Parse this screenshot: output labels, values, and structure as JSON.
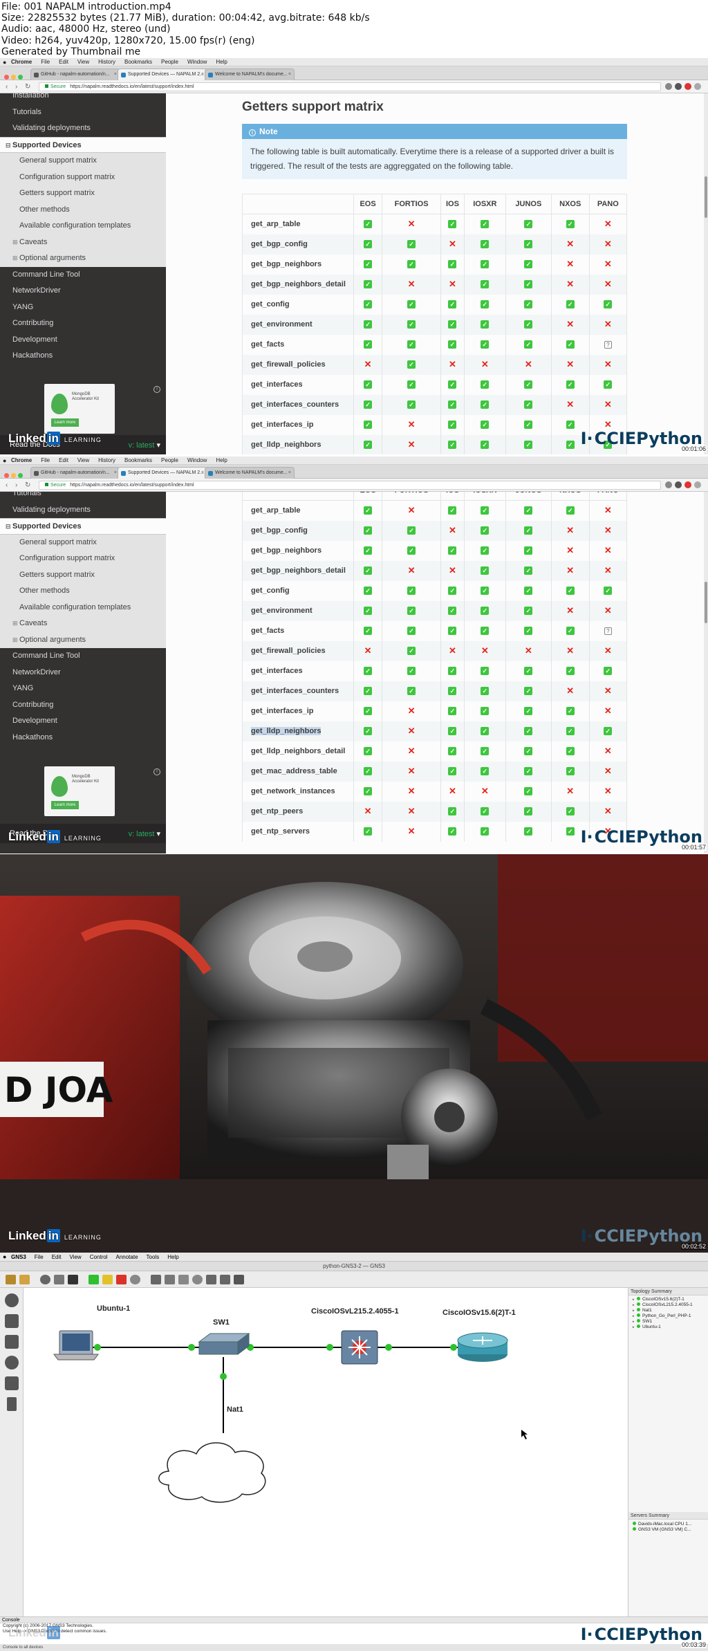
{
  "meta": {
    "lines": [
      "File: 001 NAPALM introduction.mp4",
      "Size: 22825532 bytes (21.77 MiB), duration: 00:04:42, avg.bitrate: 648 kb/s",
      "Audio: aac, 48000 Hz, stereo (und)",
      "Video: h264, yuv420p, 1280x720, 15.00 fps(r) (eng)",
      "Generated by Thumbnail me"
    ]
  },
  "browser": {
    "menu": [
      "Chrome",
      "File",
      "Edit",
      "View",
      "History",
      "Bookmarks",
      "People",
      "Window",
      "Help"
    ],
    "tabs": [
      {
        "label": "GitHub - napalm-automation/n..."
      },
      {
        "label": "Supported Devices — NAPALM 2..."
      },
      {
        "label": "Welcome to NAPALM's docume..."
      }
    ],
    "secure": "Secure",
    "url": "https://napalm.readthedocs.io/en/latest/support/index.html"
  },
  "sidebar": {
    "top_items": [
      "Installation",
      "Tutorials",
      "Validating deployments"
    ],
    "current": "Supported Devices",
    "sub_items": [
      "General support matrix",
      "Configuration support matrix",
      "Getters support matrix",
      "Other methods",
      "Available configuration templates"
    ],
    "expand_items": [
      "Caveats",
      "Optional arguments"
    ],
    "bottom_items": [
      "Command Line Tool",
      "NetworkDriver",
      "YANG",
      "Contributing",
      "Development",
      "Hackathons"
    ],
    "ad_text": "MongoDB Accelerator Kit",
    "ad_button": "Learn more",
    "rtd_label": "Read the Docs",
    "version": "v: latest"
  },
  "doc": {
    "heading": "Getters support matrix",
    "note_title": "Note",
    "note_body": "The following table is built automatically. Everytime there is a release of a supported driver a built is triggered. The result of the tests are aggreggated on the following table.",
    "columns": [
      "EOS",
      "FORTIOS",
      "IOS",
      "IOSXR",
      "JUNOS",
      "NXOS",
      "PANO"
    ],
    "rows": [
      {
        "name": "get_arp_table",
        "v": [
          "y",
          "n",
          "y",
          "y",
          "y",
          "y",
          "n"
        ]
      },
      {
        "name": "get_bgp_config",
        "v": [
          "y",
          "y",
          "n",
          "y",
          "y",
          "n",
          "n"
        ]
      },
      {
        "name": "get_bgp_neighbors",
        "v": [
          "y",
          "y",
          "y",
          "y",
          "y",
          "n",
          "n"
        ]
      },
      {
        "name": "get_bgp_neighbors_detail",
        "v": [
          "y",
          "n",
          "n",
          "y",
          "y",
          "n",
          "n"
        ]
      },
      {
        "name": "get_config",
        "v": [
          "y",
          "y",
          "y",
          "y",
          "y",
          "y",
          "y"
        ]
      },
      {
        "name": "get_environment",
        "v": [
          "y",
          "y",
          "y",
          "y",
          "y",
          "n",
          "n"
        ]
      },
      {
        "name": "get_facts",
        "v": [
          "y",
          "y",
          "y",
          "y",
          "y",
          "y",
          "z"
        ]
      },
      {
        "name": "get_firewall_policies",
        "v": [
          "n",
          "y",
          "n",
          "n",
          "n",
          "n",
          "n"
        ]
      },
      {
        "name": "get_interfaces",
        "v": [
          "y",
          "y",
          "y",
          "y",
          "y",
          "y",
          "y"
        ]
      },
      {
        "name": "get_interfaces_counters",
        "v": [
          "y",
          "y",
          "y",
          "y",
          "y",
          "n",
          "n"
        ]
      },
      {
        "name": "get_interfaces_ip",
        "v": [
          "y",
          "n",
          "y",
          "y",
          "y",
          "y",
          "n"
        ]
      },
      {
        "name": "get_lldp_neighbors",
        "v": [
          "y",
          "n",
          "y",
          "y",
          "y",
          "y",
          "y"
        ]
      },
      {
        "name": "get_lldp_neighbors_detail",
        "v": [
          "y",
          "n",
          "y",
          "y",
          "y",
          "y",
          "n"
        ]
      },
      {
        "name": "get_mac_address_table",
        "v": [
          "y",
          "n",
          "y",
          "y",
          "y",
          "y",
          "n"
        ]
      },
      {
        "name": "get_network_instances",
        "v": [
          "y",
          "n",
          "n",
          "n",
          "y",
          "n",
          "n"
        ]
      },
      {
        "name": "get_ntp_peers",
        "v": [
          "n",
          "n",
          "y",
          "y",
          "y",
          "y",
          "n"
        ]
      },
      {
        "name": "get_ntp_servers",
        "v": [
          "y",
          "n",
          "y",
          "y",
          "y",
          "y",
          "n"
        ]
      }
    ]
  },
  "watermark": {
    "linkedin": "Linked",
    "linkedin_in": "in",
    "learning": "LEARNING",
    "cciepython": "CCIEPython",
    "bars": "I·"
  },
  "timestamps": {
    "f1": "00:01:06",
    "f2": "00:01:57",
    "f3": "00:02:52",
    "f4": "00:03:39"
  },
  "plate_text": "D JOA",
  "gns3": {
    "menu": [
      "GNS3",
      "File",
      "Edit",
      "View",
      "Control",
      "Annotate",
      "Tools",
      "Help"
    ],
    "title": "python-GNS3-2 — GNS3",
    "nodes": {
      "ubuntu": "Ubuntu-1",
      "sw1": "SW1",
      "l2": "CiscoIOSvL215.2.4055-1",
      "router": "CiscoIOSv15.6(2)T-1",
      "nat": "Nat1"
    },
    "topology_header": "Topology Summary",
    "topology": [
      "CiscoIOSv15.6(2)T-1",
      "CiscoIOSvL215.2.4055-1",
      "Nat1",
      "Python_Go_Perl_PHP-1",
      "SW1",
      "Ubuntu-1"
    ],
    "servers_header": "Servers Summary",
    "servers": [
      "Davids-iMac.local CPU 1...",
      "GNS3 VM (GNS3 VM) C..."
    ],
    "console_header": "Console",
    "console_lines": [
      "Copyright (c) 2006-2017 GNS3 Technologies.",
      "Use Help -> GNS3 Doctor to detect common issues."
    ],
    "status": "Console to all devices"
  },
  "colors": {
    "check": "#3ec63e",
    "cross": "#e4241b",
    "sidebar": "#343131",
    "note": "#6ab0de",
    "link_green": "#2ec02e"
  }
}
